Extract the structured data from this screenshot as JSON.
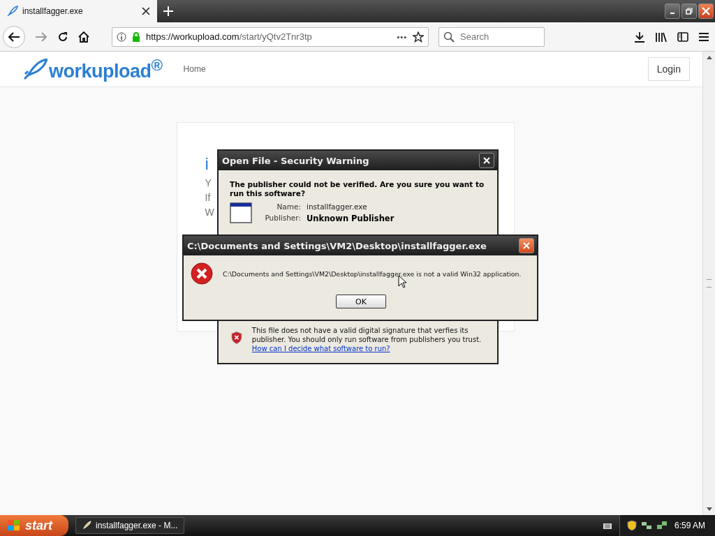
{
  "browser": {
    "tabs": [
      {
        "title": "installfagger.exe",
        "selected": true
      }
    ],
    "forward": {
      "disabled": true
    },
    "url": {
      "host": "https://workupload.com",
      "path": "/start/yQtv2Tnr3tp",
      "dots": "•••"
    },
    "search": {
      "placeholder": "Search"
    }
  },
  "site": {
    "logo": "workupload$^{®}$",
    "nav": [
      {
        "label": "Home"
      }
    ],
    "login": "Login",
    "card": {
      "heading": "i",
      "lines": [
        "Y",
        "If",
        "W"
      ]
    }
  },
  "security_dialog": {
    "title": "Open File - Security Warning",
    "question": "The publisher could not be verified.  Are you sure you want to run this software?",
    "fields": [
      {
        "label": "Name:",
        "value": "installfagger.exe",
        "bold": false
      },
      {
        "label": "Publisher:",
        "value": "Unknown Publisher",
        "bold": true
      }
    ],
    "warning": "This file does not have a valid digital signature that verfies its publisher.  You should only run software from publishers you trust.",
    "help_link": "How can I decide what software to run?"
  },
  "error_dialog": {
    "title": "C:\\Documents and Settings\\VM2\\Desktop\\installfagger.exe",
    "message": "C:\\Documents and Settings\\VM2\\Desktop\\installfagger.exe is not a valid Win32 application.",
    "button": "OK"
  },
  "taskbar": {
    "start": "start",
    "tasks": [
      {
        "label": "installfagger.exe - M...",
        "selected": false
      }
    ],
    "clock": "6:59 AM"
  }
}
